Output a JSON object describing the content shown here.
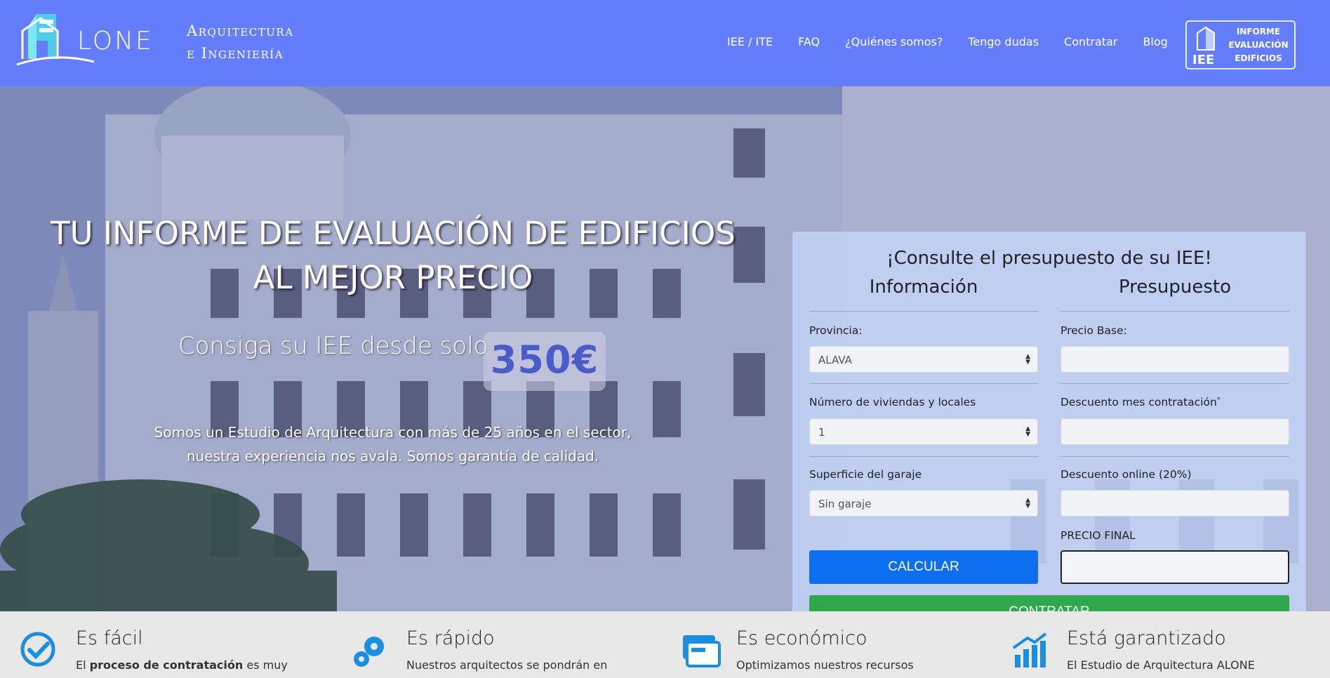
{
  "header": {
    "logo_text": "LONE",
    "tagline_line1": "Arquitectura",
    "tagline_line2": "e Ingeniería",
    "nav": [
      "IEE / ITE",
      "FAQ",
      "¿Quiénes somos?",
      "Tengo dudas",
      "Contratar",
      "Blog"
    ],
    "badge": {
      "short": "IEE",
      "line1": "INFORME",
      "line2": "EVALUACIÓN",
      "line3": "EDIFICIOS"
    }
  },
  "hero": {
    "headline_line1": "TU INFORME DE EVALUACIÓN DE EDIFICIOS",
    "headline_line2": "AL MEJOR PRECIO",
    "price_prefix": "Consiga su IEE desde solo",
    "price": "350€",
    "subtitle_line1": "Somos un Estudio de Arquitectura con más de 25 años en el sector,",
    "subtitle_line2": "nuestra experiencia nos avala. Somos garantía de calidad."
  },
  "quote": {
    "title": "¡Consulte el presupuesto de su IEE!",
    "col_info": "Información",
    "col_budget": "Presupuesto",
    "provincia_label": "Provincia:",
    "provincia_value": "ALAVA",
    "viviendas_label": "Número de viviendas y locales",
    "viviendas_value": "1",
    "garaje_label": "Superficie del garaje",
    "garaje_value": "Sin garaje",
    "precio_base_label": "Precio Base:",
    "descuento_mes_label": "Descuento mes contratación",
    "descuento_mes_mark": "*",
    "descuento_online_label": "Descuento online (20%)",
    "precio_final_label": "PRECIO FINAL",
    "calc_button": "CALCULAR",
    "hire_button": "CONTRATAR"
  },
  "features": [
    {
      "title": "Es fácil",
      "text_plain": "El ",
      "text_bold": "proceso de contratación",
      "text_after": " es muy"
    },
    {
      "title": "Es rápido",
      "text_plain": "Nuestros arquitectos se pondrán en",
      "text_bold": "",
      "text_after": ""
    },
    {
      "title": "Es económico",
      "text_plain": "Optimizamos nuestros recursos",
      "text_bold": "",
      "text_after": ""
    },
    {
      "title": "Está garantizado",
      "text_plain": "El Estudio de Arquitectura ALONE",
      "text_bold": "",
      "text_after": ""
    }
  ],
  "colors": {
    "header_bg": "#647dfa",
    "calc_button": "#0e6ef0",
    "hire_button": "#2ea84a",
    "icon_blue": "#1a8fe0",
    "price_text": "#4a5cc8"
  }
}
